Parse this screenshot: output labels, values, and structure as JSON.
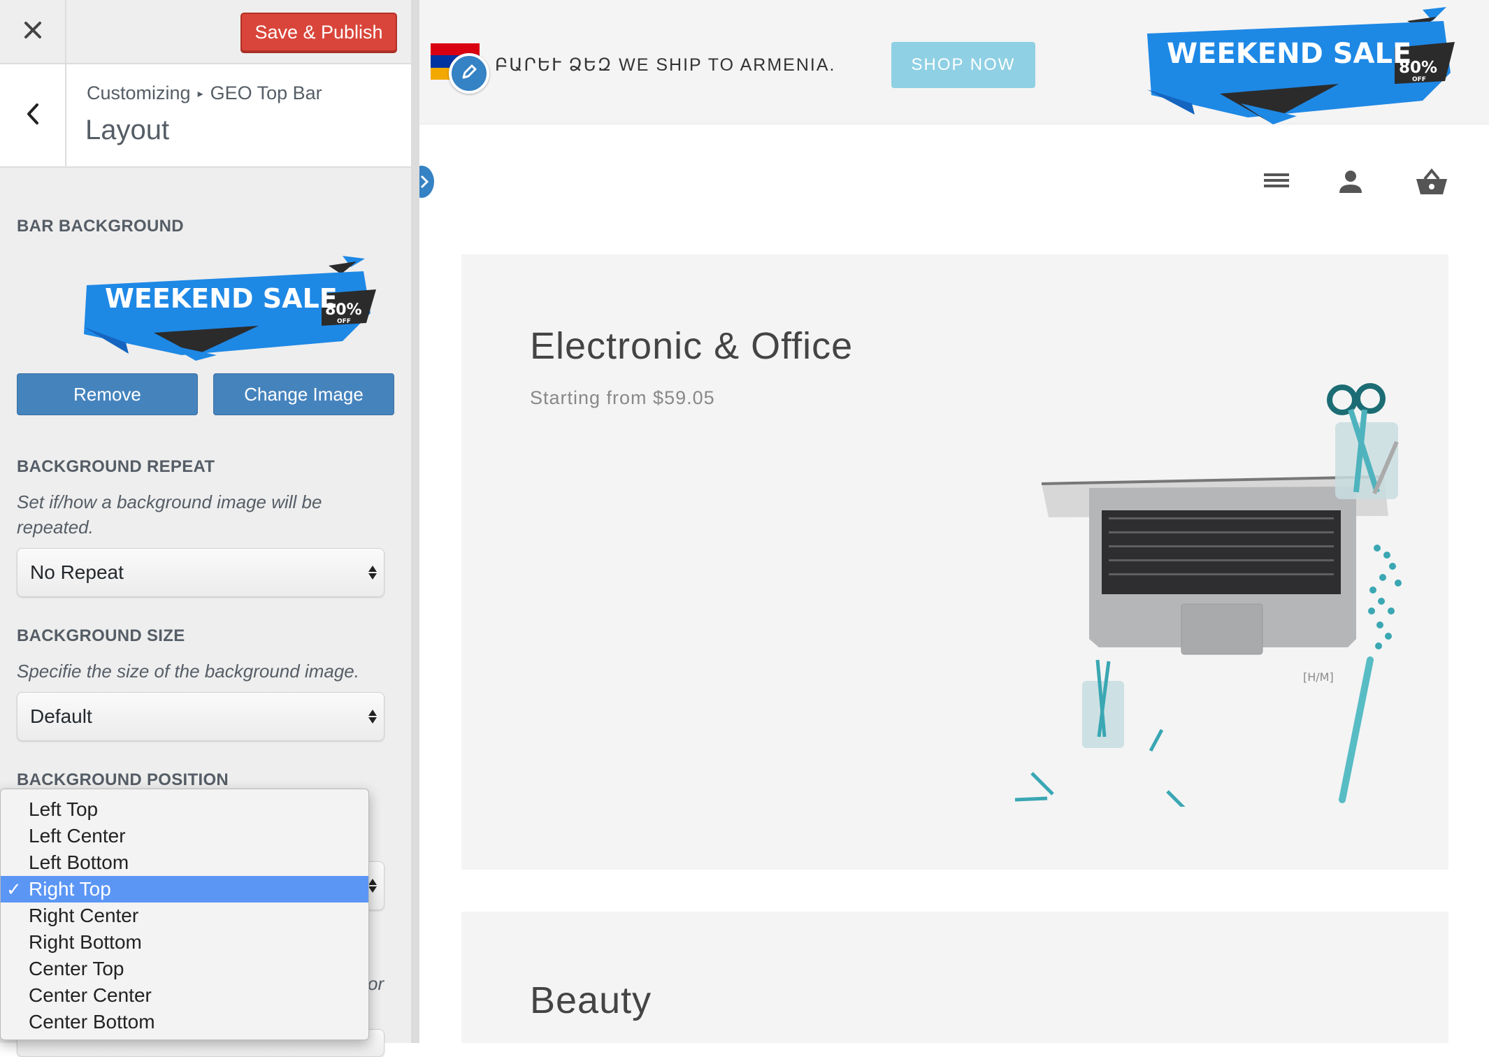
{
  "customizer": {
    "close_icon": "close-icon",
    "save_label": "Save & Publish",
    "breadcrumb": {
      "root": "Customizing",
      "section": "GEO Top Bar"
    },
    "section_title": "Layout",
    "bar_background": {
      "label": "BAR BACKGROUND",
      "remove_label": "Remove",
      "change_label": "Change Image"
    },
    "background_repeat": {
      "label": "BACKGROUND REPEAT",
      "description": "Set if/how a background image will be repeated.",
      "value": "No Repeat"
    },
    "background_size": {
      "label": "BACKGROUND SIZE",
      "description": "Specifie the size of the background image.",
      "value": "Default"
    },
    "background_position": {
      "label": "BACKGROUND POSITION",
      "options": [
        "Left Top",
        "Left Center",
        "Left Bottom",
        "Right Top",
        "Right Center",
        "Right Bottom",
        "Center Top",
        "Center Center",
        "Center Bottom"
      ],
      "selected": "Right Top",
      "partial_text": "or"
    }
  },
  "banner": {
    "line1": "WEEKEND SALE",
    "percent": "80%",
    "off": "OFF"
  },
  "preview": {
    "geo_message": "ԲԱՐԵՒ ՁԵԶ WE SHIP TO ARMENIA.",
    "shop_now": "SHOP NOW",
    "cards": [
      {
        "title": "Electronic & Office",
        "subtitle": "Starting from $59.05"
      },
      {
        "title": "Beauty"
      }
    ],
    "icons": [
      "menu-icon",
      "user-icon",
      "basket-icon"
    ]
  },
  "colors": {
    "save_button": "#d9453a",
    "primary_button": "#4583bd",
    "shop_now": "#8fd0e4",
    "selection": "#5b96f5",
    "banner_blue": "#1e88e5"
  }
}
